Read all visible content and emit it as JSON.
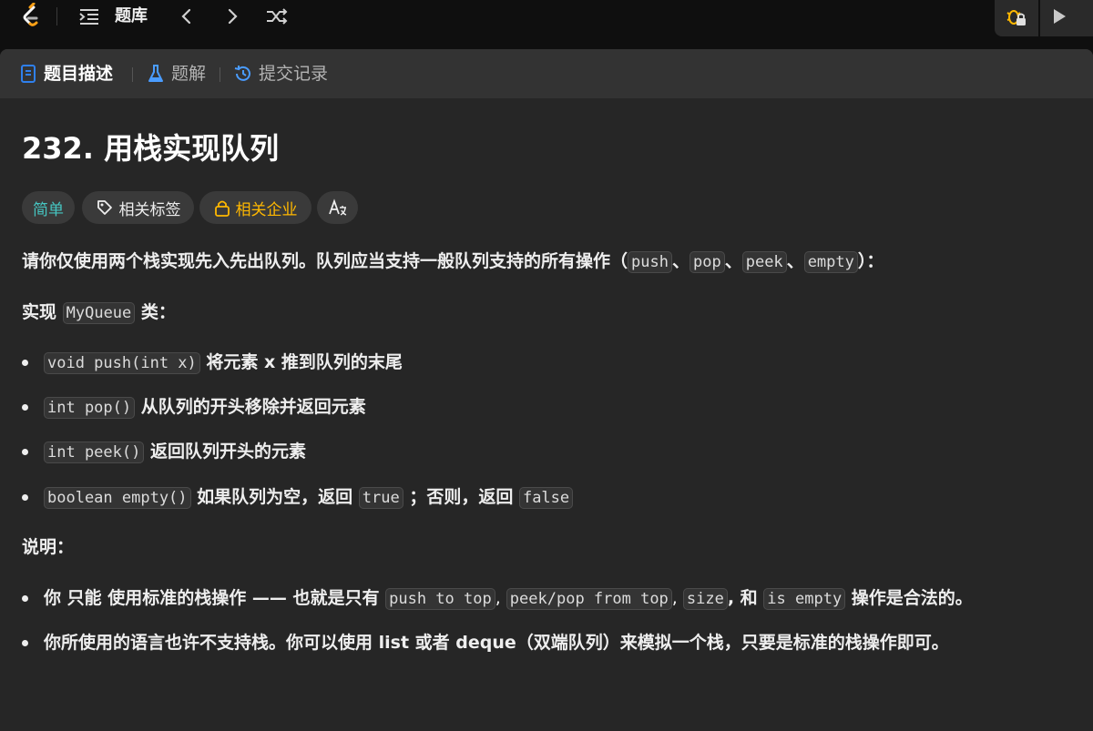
{
  "nav": {
    "title": "题库"
  },
  "tabs": [
    {
      "label": "题目描述"
    },
    {
      "label": "题解"
    },
    {
      "label": "提交记录"
    }
  ],
  "problem": {
    "title": "232. 用栈实现队列",
    "tags": {
      "difficulty": "简单",
      "related_tags": "相关标签",
      "related_companies": "相关企业"
    },
    "intro_text": "请你仅使用两个栈实现先入先出队列。队列应当支持一般队列支持的所有操作（",
    "intro_ops": [
      "push",
      "pop",
      "peek",
      "empty"
    ],
    "intro_sep": "、",
    "intro_end": "）：",
    "impl_prefix": "实现 ",
    "impl_code": "MyQueue",
    "impl_suffix": " 类：",
    "methods": [
      {
        "code": "void push(int x)",
        "text": " 将元素 x 推到队列的末尾"
      },
      {
        "code": "int pop()",
        "text": " 从队列的开头移除并返回元素"
      },
      {
        "code": "int peek()",
        "text": " 返回队列开头的元素"
      },
      {
        "code": "boolean empty()",
        "text": " 如果队列为空，返回 ",
        "code2": "true",
        "text2": " ；否则，返回 ",
        "code3": "false"
      }
    ],
    "notes_heading": "说明：",
    "note1": {
      "a": "你 ",
      "b": "只能",
      "c": " 使用标准的栈操作 —— 也就是只有 ",
      "ops": [
        "push to top",
        "peek/pop from top",
        "size"
      ],
      "d": ", 和 ",
      "e": "is empty",
      "f": " 操作是合法的。"
    },
    "note2": "你所使用的语言也许不支持栈。你可以使用 list 或者 deque（双端队列）来模拟一个栈，只要是标准的栈操作即可。"
  },
  "colors": {
    "easy": "#46c6c2",
    "company": "#ffb800",
    "tab_icon_desc": "#2f80ed",
    "tab_icon_sol": "#4a9cff"
  }
}
